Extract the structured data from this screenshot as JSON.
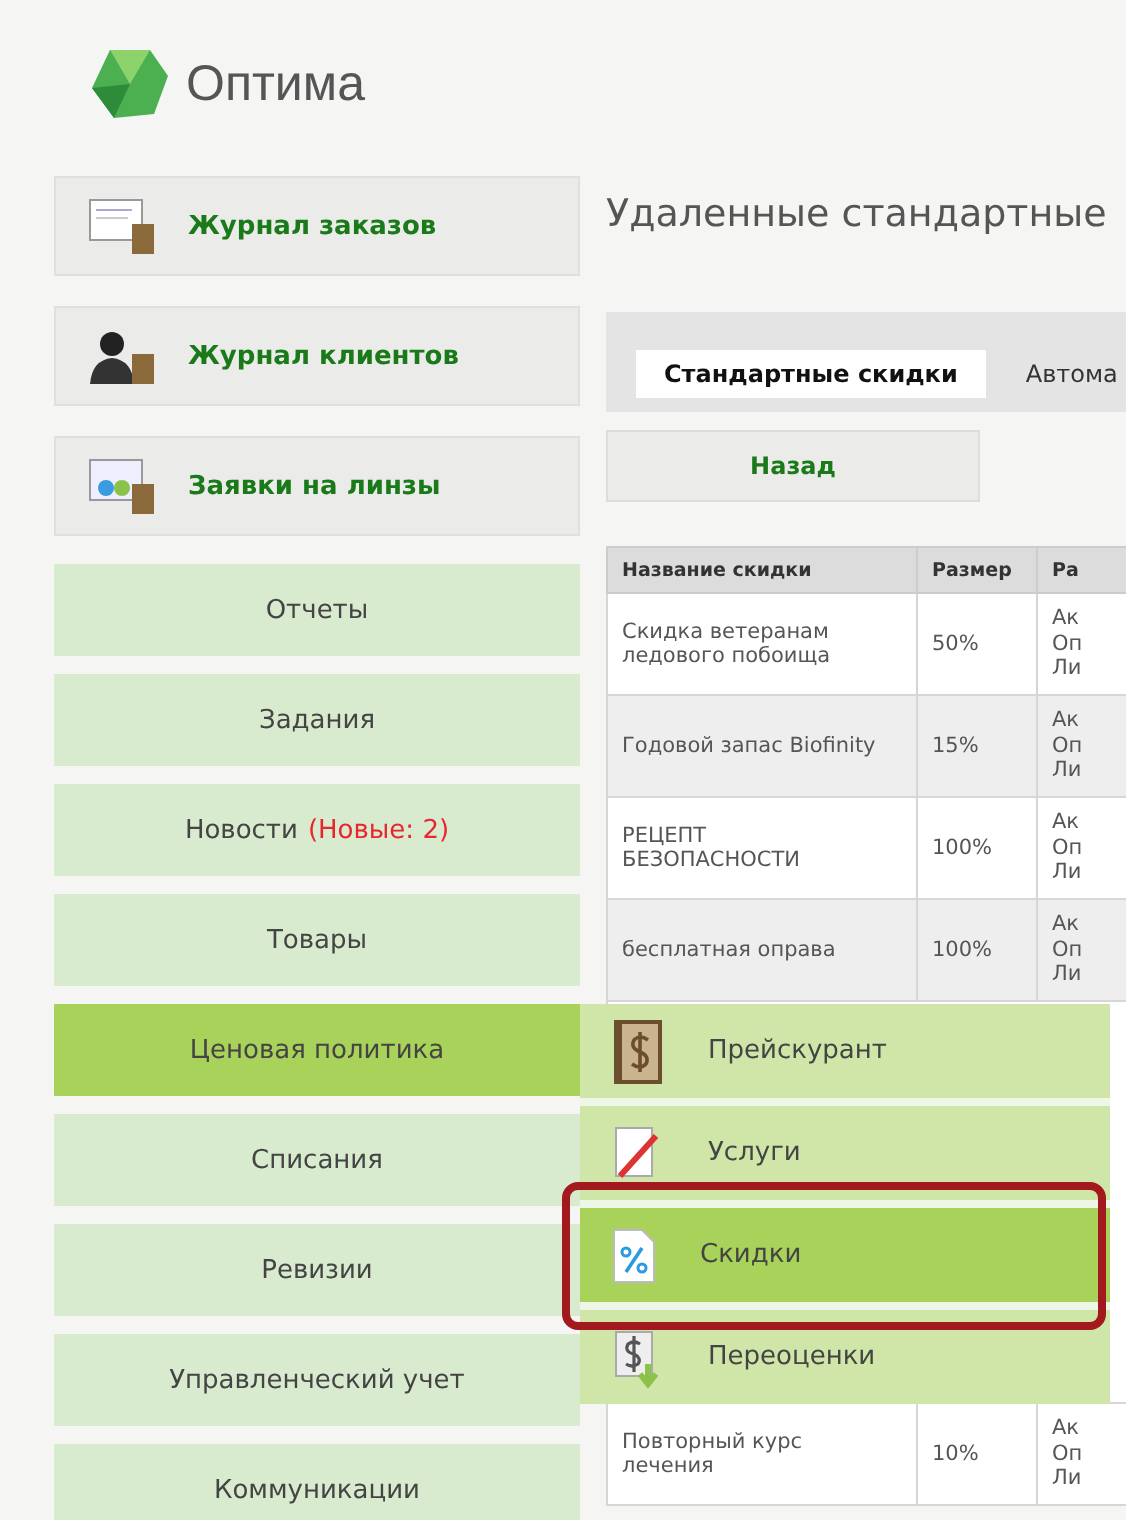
{
  "logo": {
    "title": "Оптима"
  },
  "sidebar": {
    "journals": [
      {
        "label": "Журнал заказов",
        "kind": "orders"
      },
      {
        "label": "Журнал клиентов",
        "kind": "clients"
      },
      {
        "label": "Заявки на линзы",
        "kind": "lenses"
      }
    ],
    "menu": [
      {
        "label": "Отчеты",
        "selected": false
      },
      {
        "label": "Задания",
        "selected": false
      },
      {
        "label": "Новости",
        "badge": "(Новые: 2)",
        "selected": false
      },
      {
        "label": "Товары",
        "selected": false
      },
      {
        "label": "Ценовая политика",
        "selected": true
      },
      {
        "label": "Списания",
        "selected": false
      },
      {
        "label": "Ревизии",
        "selected": false
      },
      {
        "label": "Управленческий учет",
        "selected": false
      },
      {
        "label": "Коммуникации",
        "selected": false
      }
    ]
  },
  "submenu": [
    {
      "label": "Прейскурант",
      "kind": "price-book",
      "selected": false
    },
    {
      "label": "Услуги",
      "kind": "services",
      "selected": false
    },
    {
      "label": "Скидки",
      "kind": "discount",
      "selected": true
    },
    {
      "label": "Переоценки",
      "kind": "revaluation",
      "selected": false
    }
  ],
  "main": {
    "title": "Удаленные стандартные",
    "tabs": [
      {
        "label": "Стандартные скидки",
        "selected": true
      },
      {
        "label": "Автома",
        "selected": false
      }
    ],
    "back_button": "Назад",
    "table": {
      "columns": [
        "Название скидки",
        "Размер",
        "Ра"
      ],
      "rows": [
        {
          "name": "Скидка ветеранам ледового побоища",
          "size": "50%",
          "column_3": [
            "Ак",
            "Оп",
            "Ли"
          ]
        },
        {
          "name": "Годовой запас Biofinity",
          "size": "15%",
          "column_3": [
            "Ак",
            "Оп",
            "Ли"
          ]
        },
        {
          "name": "РЕЦЕПТ БЕЗОПАСНОСТИ",
          "size": "100%",
          "column_3": [
            "Ак",
            "Оп",
            "Ли"
          ]
        },
        {
          "name": "бесплатная оправа",
          "size": "100%",
          "column_3": [
            "Ак",
            "Оп",
            "Ли"
          ]
        }
      ],
      "rows_below_menu": [
        {
          "name": "Повторный курс лечения",
          "size": "10%",
          "column_3": [
            "Ак",
            "Оп",
            "Ли"
          ]
        }
      ]
    }
  }
}
